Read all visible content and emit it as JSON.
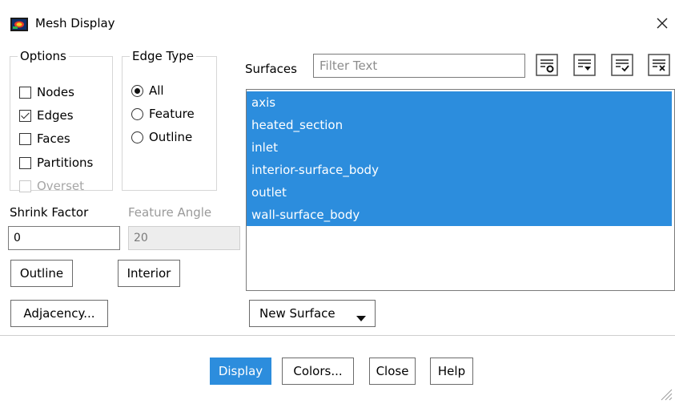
{
  "window": {
    "title": "Mesh Display",
    "icon": "mesh-display-app-icon"
  },
  "options": {
    "legend": "Options",
    "items": [
      {
        "label": "Nodes",
        "checked": false,
        "enabled": true
      },
      {
        "label": "Edges",
        "checked": true,
        "enabled": true
      },
      {
        "label": "Faces",
        "checked": false,
        "enabled": true
      },
      {
        "label": "Partitions",
        "checked": false,
        "enabled": true
      },
      {
        "label": "Overset",
        "checked": false,
        "enabled": false
      }
    ]
  },
  "edge_type": {
    "legend": "Edge Type",
    "items": [
      {
        "label": "All",
        "selected": true
      },
      {
        "label": "Feature",
        "selected": false
      },
      {
        "label": "Outline",
        "selected": false
      }
    ]
  },
  "shrink_factor": {
    "label": "Shrink Factor",
    "value": "0"
  },
  "feature_angle": {
    "label": "Feature Angle",
    "value": "20",
    "enabled": false
  },
  "buttons": {
    "outline": "Outline",
    "interior": "Interior",
    "adjacency": "Adjacency...",
    "new_surface": "New Surface",
    "display": "Display",
    "colors": "Colors...",
    "close": "Close",
    "help": "Help"
  },
  "surfaces": {
    "label": "Surfaces",
    "filter_placeholder": "Filter Text",
    "items": [
      {
        "label": "axis",
        "selected": true
      },
      {
        "label": "heated_section",
        "selected": true
      },
      {
        "label": "inlet",
        "selected": true
      },
      {
        "label": "interior-surface_body",
        "selected": true
      },
      {
        "label": "outlet",
        "selected": true
      },
      {
        "label": "wall-surface_body",
        "selected": true
      }
    ],
    "tool_icons": [
      "filter-options-icon",
      "select-all-icon",
      "select-some-icon",
      "deselect-all-icon"
    ]
  },
  "colors": {
    "accent": "#2c8ddd",
    "border": "#6b6b6b",
    "disabled_text": "#a6a6a6"
  }
}
